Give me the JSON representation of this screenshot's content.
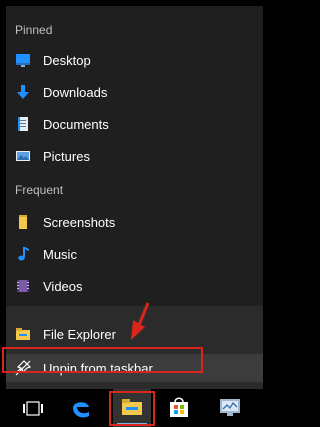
{
  "jumplist": {
    "pinned_header": "Pinned",
    "pinned_items": [
      {
        "label": "Desktop",
        "icon": "desktop-icon"
      },
      {
        "label": "Downloads",
        "icon": "downloads-icon"
      },
      {
        "label": "Documents",
        "icon": "documents-icon"
      },
      {
        "label": "Pictures",
        "icon": "pictures-icon"
      }
    ],
    "frequent_header": "Frequent",
    "frequent_items": [
      {
        "label": "Screenshots",
        "icon": "folder-icon"
      },
      {
        "label": "Music",
        "icon": "music-icon"
      },
      {
        "label": "Videos",
        "icon": "videos-icon"
      }
    ],
    "actions": [
      {
        "label": "File Explorer",
        "icon": "file-explorer-icon"
      },
      {
        "label": "Unpin from taskbar",
        "icon": "unpin-icon"
      }
    ]
  },
  "taskbar": {
    "items": [
      {
        "name": "task-view-icon"
      },
      {
        "name": "edge-icon"
      },
      {
        "name": "file-explorer-icon",
        "active": true
      },
      {
        "name": "store-icon"
      },
      {
        "name": "control-panel-icon"
      }
    ]
  },
  "colors": {
    "accent": "#0078d7",
    "highlight": "#d9261c",
    "folder": "#f2c94c"
  }
}
